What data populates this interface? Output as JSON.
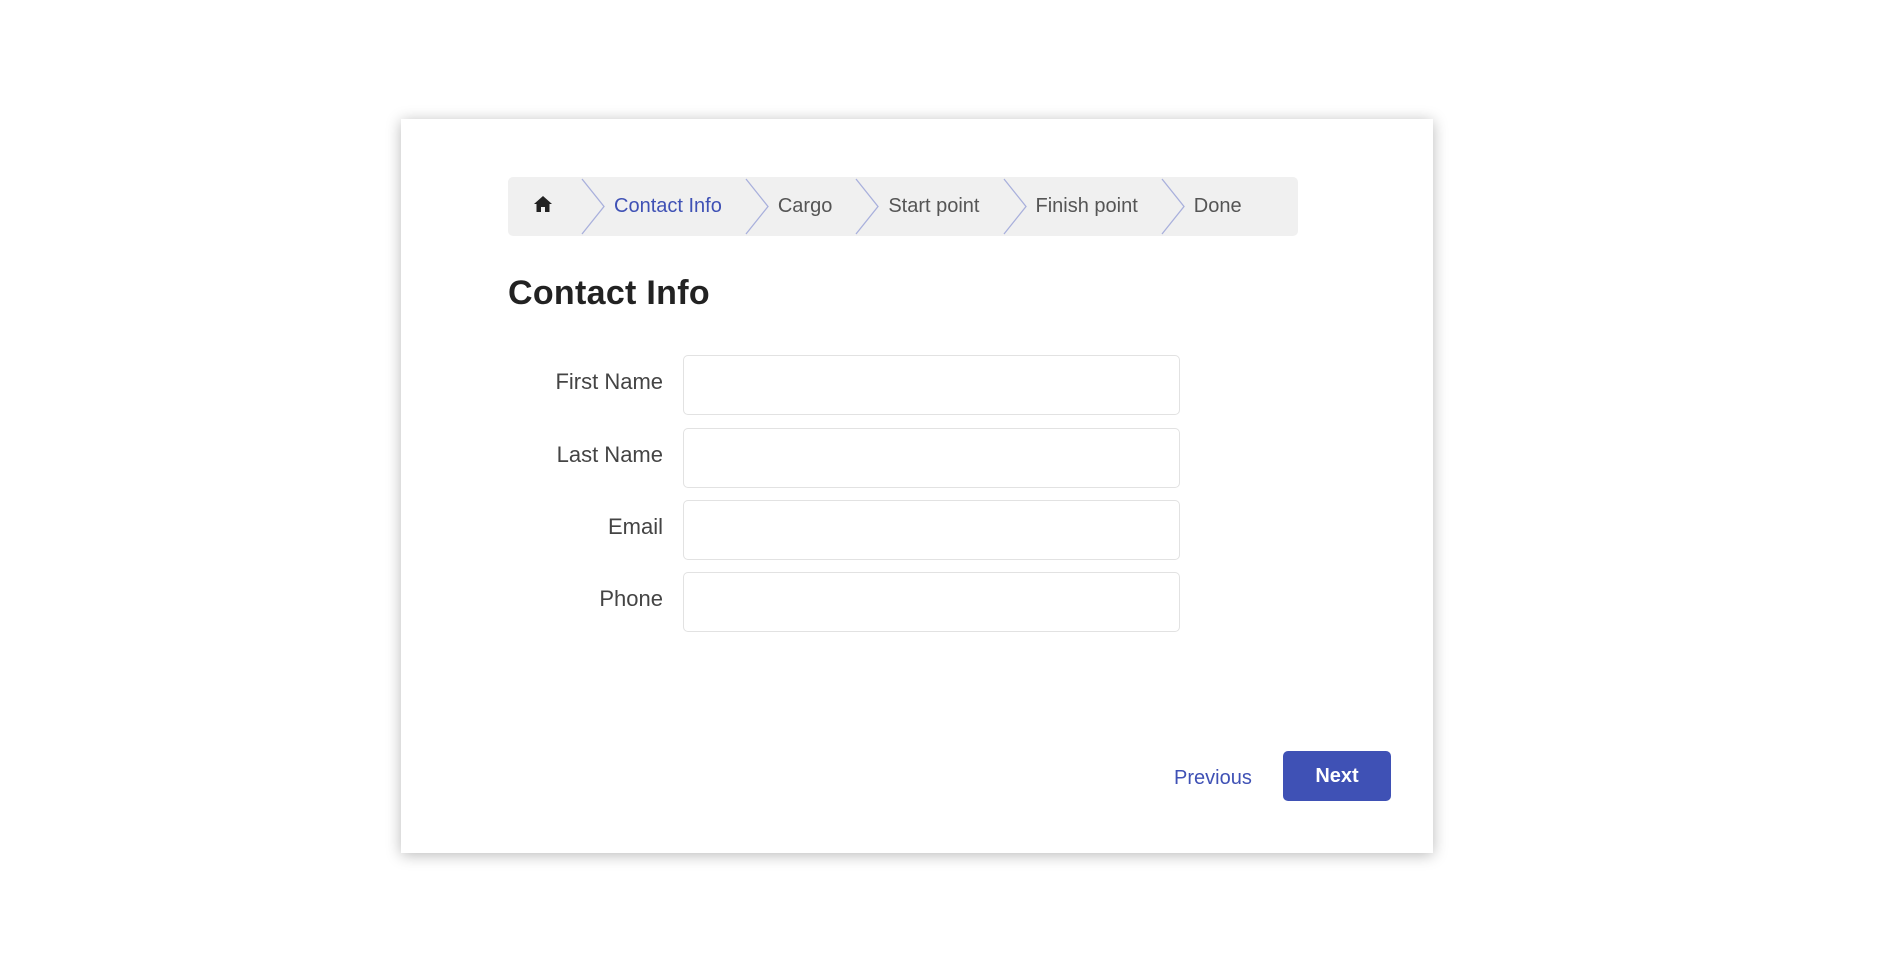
{
  "breadcrumb": {
    "home_icon": "home-icon",
    "items": [
      {
        "label": "Contact Info",
        "active": true
      },
      {
        "label": "Cargo",
        "active": false
      },
      {
        "label": "Start point",
        "active": false
      },
      {
        "label": "Finish point",
        "active": false
      },
      {
        "label": "Done",
        "active": false
      }
    ]
  },
  "page": {
    "title": "Contact Info"
  },
  "form": {
    "fields": [
      {
        "label": "First Name",
        "value": "",
        "placeholder": ""
      },
      {
        "label": "Last Name",
        "value": "",
        "placeholder": ""
      },
      {
        "label": "Email",
        "value": "",
        "placeholder": ""
      },
      {
        "label": "Phone",
        "value": "",
        "placeholder": ""
      }
    ]
  },
  "actions": {
    "previous_label": "Previous",
    "next_label": "Next"
  },
  "colors": {
    "accent": "#3f51b5",
    "breadcrumb_bg": "#f0f0f0"
  }
}
